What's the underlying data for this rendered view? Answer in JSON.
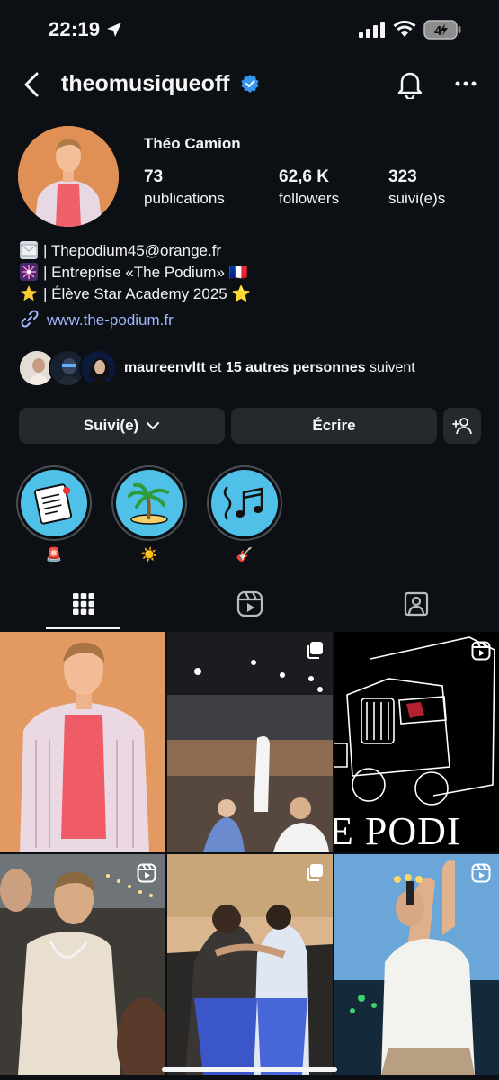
{
  "status_bar": {
    "time": "22:19",
    "battery": "4"
  },
  "header": {
    "username": "theomusiqueoff"
  },
  "profile": {
    "full_name": "Théo Camion",
    "stats": [
      {
        "value": "73",
        "label": "publications"
      },
      {
        "value": "62,6 K",
        "label": "followers"
      },
      {
        "value": "323",
        "label": "suivi(e)s"
      }
    ],
    "bio": [
      {
        "icon": "envelope-emoji",
        "text": "| Thepodium45@orange.fr"
      },
      {
        "icon": "firework-emoji",
        "text": "| Entreprise «The Podium» 🇫🇷"
      },
      {
        "icon": "star-emoji",
        "text": "| Élève Star Academy 2025 ⭐"
      }
    ],
    "link": "www.the-podium.fr",
    "followed_by": {
      "name": "maureenvltt",
      "middle": " et ",
      "others": "15 autres personnes",
      "suffix": " suivent"
    }
  },
  "actions": {
    "following_label": "Suivi(e)",
    "message_label": "Écrire"
  },
  "highlights": [
    {
      "label": "🚨",
      "icon": "setlist-icon"
    },
    {
      "label": "☀️",
      "icon": "palm-island-icon"
    },
    {
      "label": "🎸",
      "icon": "music-notes-icon"
    }
  ],
  "tabs": [
    {
      "name": "grid",
      "icon": "grid-icon",
      "active": true
    },
    {
      "name": "reels",
      "icon": "reels-icon",
      "active": false
    },
    {
      "name": "tagged",
      "icon": "tagged-icon",
      "active": false
    }
  ],
  "posts": [
    {
      "type": "photo",
      "badge": ""
    },
    {
      "type": "carousel",
      "badge": "carousel-icon"
    },
    {
      "type": "reel",
      "badge": "reel-icon",
      "caption": "E PODI"
    },
    {
      "type": "reel",
      "badge": "reel-icon"
    },
    {
      "type": "carousel",
      "badge": "carousel-icon"
    },
    {
      "type": "reel",
      "badge": "reel-icon"
    }
  ],
  "colors": {
    "background": "#0c1014",
    "button": "#25292e",
    "link": "#a0b8ff",
    "verified": "#3797f0",
    "highlight": "#4fc1e9"
  }
}
